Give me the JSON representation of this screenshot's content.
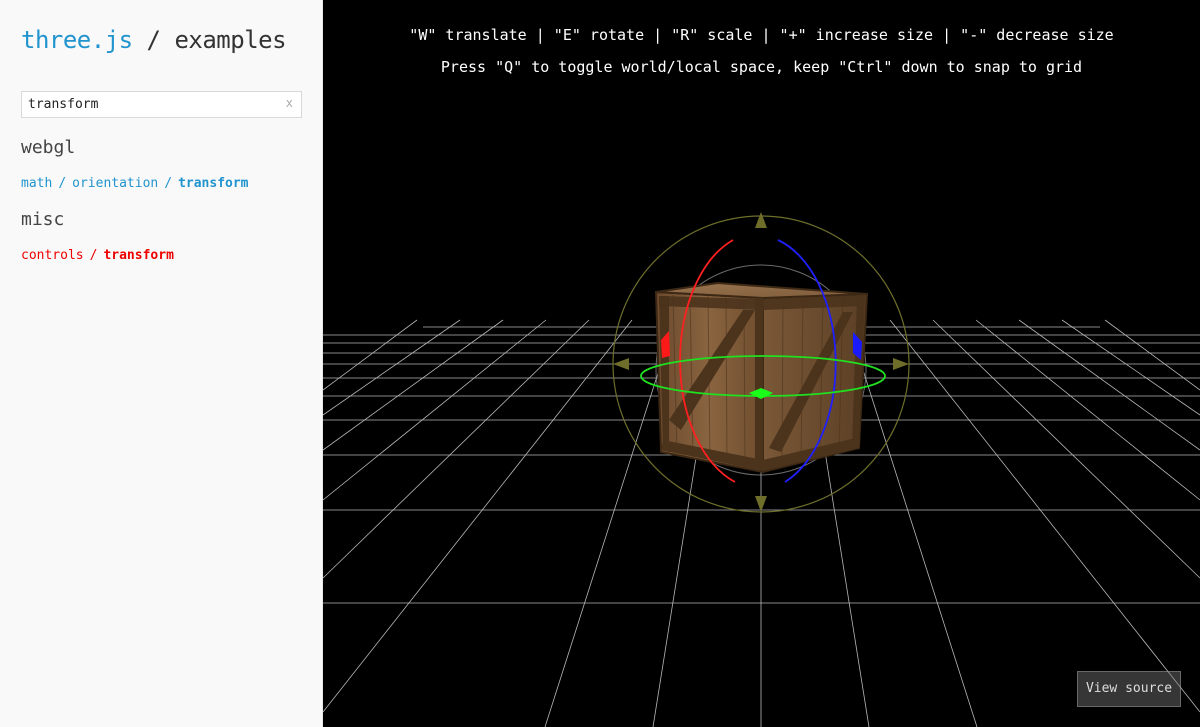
{
  "sidebar": {
    "title_brand": "three.js",
    "title_separator": " / ",
    "title_section": "examples",
    "search": {
      "value": "transform",
      "clear_label": "x"
    },
    "groups": [
      {
        "category": "webgl",
        "crumbs": [
          "math",
          "orientation"
        ],
        "current": "transform",
        "color": "#2194ce"
      },
      {
        "category": "misc",
        "crumbs": [
          "controls"
        ],
        "current": "transform",
        "color": "#ee0000"
      }
    ]
  },
  "viewport": {
    "info_line1": "\"W\" translate | \"E\" rotate | \"R\" scale | \"+\" increase size | \"-\" decrease size",
    "info_line2": "Press \"Q\" to toggle world/local space, keep \"Ctrl\" down to snap to grid",
    "view_source_label": "View source"
  }
}
